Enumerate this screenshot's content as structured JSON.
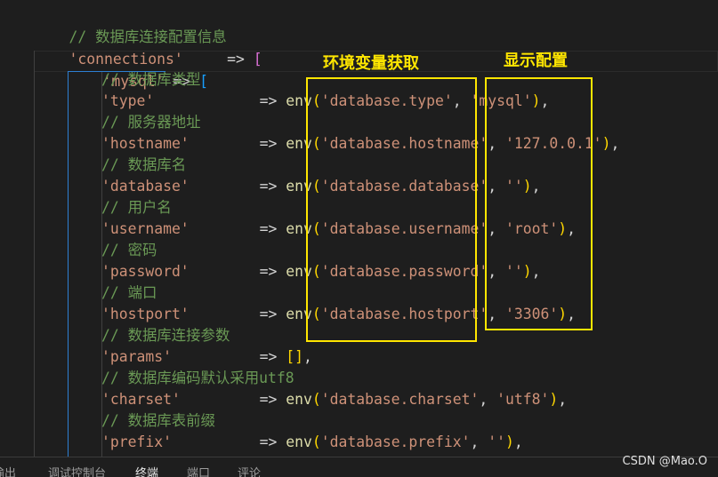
{
  "code": {
    "comment_db_conn": "// 数据库连接配置信息",
    "connections_key": "'connections'",
    "arrow": "=>",
    "open_bracket": "[",
    "mysql_key": "'mysql'",
    "comment_type": "// 数据库类型",
    "type_key": "'type'",
    "type_env_key": "'database.type'",
    "type_default": "'mysql'",
    "comment_hostname": "// 服务器地址",
    "hostname_key": "'hostname'",
    "hostname_env_key": "'database.hostname'",
    "hostname_default": "'127.0.0.1'",
    "comment_database": "// 数据库名",
    "database_key": "'database'",
    "database_env_key": "'database.database'",
    "database_default": "''",
    "comment_username": "// 用户名",
    "username_key": "'username'",
    "username_env_key": "'database.username'",
    "username_default": "'root'",
    "comment_password": "// 密码",
    "password_key": "'password'",
    "password_env_key": "'database.password'",
    "password_default": "''",
    "comment_hostport": "// 端口",
    "hostport_key": "'hostport'",
    "hostport_env_key": "'database.hostport'",
    "hostport_default": "'3306'",
    "comment_params": "// 数据库连接参数",
    "params_key": "'params'",
    "params_value": "[]",
    "comment_charset": "// 数据库编码默认采用utf8",
    "charset_key": "'charset'",
    "charset_env_key": "'database.charset'",
    "charset_default": "'utf8'",
    "comment_prefix": "// 数据库表前缀",
    "prefix_key": "'prefix'",
    "prefix_env_key": "'database.prefix'",
    "prefix_default": "''",
    "env_fn": "env"
  },
  "annotations": {
    "env_label": "环境变量获取",
    "default_label": "显示配置"
  },
  "panel": {
    "tabs": [
      "输出",
      "调试控制台",
      "终端",
      "端口",
      "评论"
    ],
    "active_tab": "终端"
  },
  "watermark": "CSDN @Mao.O",
  "colors": {
    "background": "#1e1e1e",
    "comment": "#6a9955",
    "string": "#ce9178",
    "function": "#dcdcaa",
    "bracket_l1": "#da70d6",
    "bracket_l2": "#179fff",
    "bracket_l3": "#ffd700",
    "annotation": "#ffe600"
  }
}
